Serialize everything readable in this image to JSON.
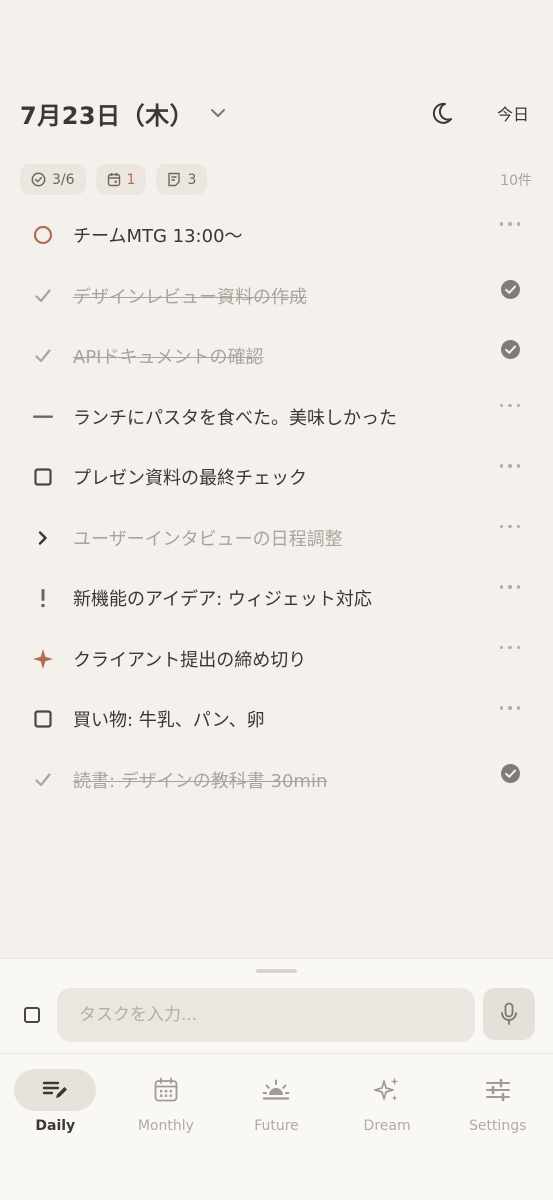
{
  "header": {
    "date": "7月23日（木）",
    "today_label": "今日"
  },
  "stats": {
    "done": "3/6",
    "events": "1",
    "notes": "3",
    "total": "10件"
  },
  "tasks": [
    {
      "text": "チームMTG 13:00〜",
      "type": "event",
      "state": "open",
      "badge": "more"
    },
    {
      "text": "デザインレビュー資料の作成",
      "type": "task",
      "state": "done",
      "badge": "check"
    },
    {
      "text": "APIドキュメントの確認",
      "type": "task",
      "state": "done",
      "badge": "check"
    },
    {
      "text": "ランチにパスタを食べた。美味しかった",
      "type": "note",
      "state": "open",
      "badge": "more"
    },
    {
      "text": "プレゼン資料の最終チェック",
      "type": "task",
      "state": "open",
      "badge": "more"
    },
    {
      "text": "ユーザーインタビューの日程調整",
      "type": "migrated",
      "state": "dim",
      "badge": "more"
    },
    {
      "text": "新機能のアイデア: ウィジェット対応",
      "type": "idea",
      "state": "open",
      "badge": "more"
    },
    {
      "text": "クライアント提出の締め切り",
      "type": "important",
      "state": "open",
      "badge": "more"
    },
    {
      "text": "買い物: 牛乳、パン、卵",
      "type": "task",
      "state": "open",
      "badge": "more"
    },
    {
      "text": "読書: デザインの教科書 30min",
      "type": "task",
      "state": "done",
      "badge": "check"
    }
  ],
  "input": {
    "placeholder": "タスクを入力..."
  },
  "nav": [
    {
      "label": "Daily",
      "icon": "daily-icon",
      "active": true
    },
    {
      "label": "Monthly",
      "icon": "calendar-icon",
      "active": false
    },
    {
      "label": "Future",
      "icon": "sunrise-icon",
      "active": false
    },
    {
      "label": "Dream",
      "icon": "sparkle-icon",
      "active": false
    },
    {
      "label": "Settings",
      "icon": "sliders-icon",
      "active": false
    }
  ],
  "colors": {
    "background": "#f4f1ec",
    "accent": "#b36b55",
    "text": "#3a3734",
    "muted": "#a9a49d"
  }
}
